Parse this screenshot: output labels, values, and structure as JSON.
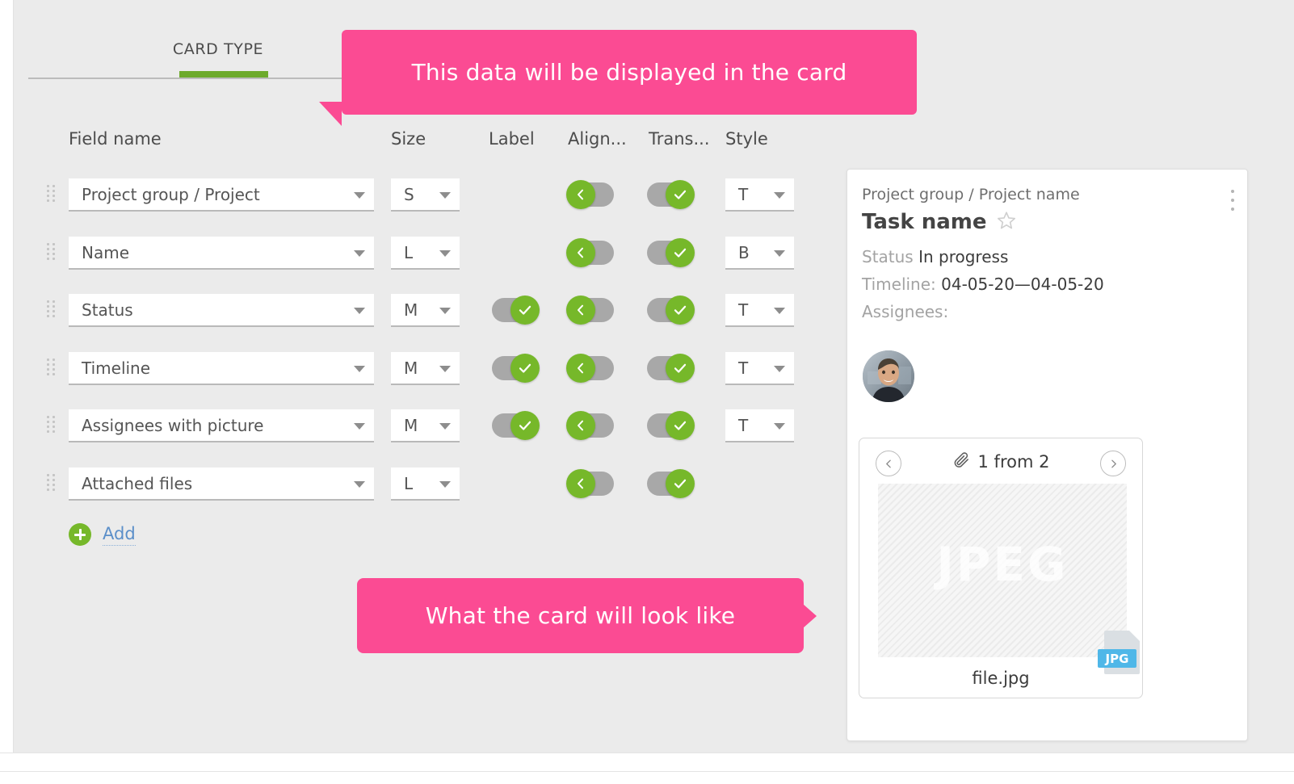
{
  "tabs": {
    "active_label": "CARD TYPE",
    "accent_color": "#6daa2c"
  },
  "columns": {
    "field_name": "Field name",
    "size": "Size",
    "label": "Label",
    "align": "Align...",
    "trans": "Trans...",
    "style": "Style"
  },
  "rows": [
    {
      "field": "Project group / Project",
      "size": "S",
      "label_toggle": null,
      "align_toggle": "off",
      "trans_toggle": "on",
      "style": "T"
    },
    {
      "field": "Name",
      "size": "L",
      "label_toggle": null,
      "align_toggle": "off",
      "trans_toggle": "on",
      "style": "B"
    },
    {
      "field": "Status",
      "size": "M",
      "label_toggle": "on",
      "align_toggle": "off",
      "trans_toggle": "on",
      "style": "T"
    },
    {
      "field": "Timeline",
      "size": "M",
      "label_toggle": "on",
      "align_toggle": "off",
      "trans_toggle": "on",
      "style": "T"
    },
    {
      "field": "Assignees with picture",
      "size": "M",
      "label_toggle": "on",
      "align_toggle": "off",
      "trans_toggle": "on",
      "style": "T"
    },
    {
      "field": "Attached files",
      "size": "L",
      "label_toggle": null,
      "align_toggle": "off",
      "trans_toggle": "on",
      "style": null
    }
  ],
  "add_button": {
    "label": "Add",
    "icon": "plus-circle-icon"
  },
  "callouts": {
    "top": "This data will be displayed in the card",
    "bottom": "What the card will look like",
    "color": "#fb4b93"
  },
  "preview": {
    "project": "Project group / Project name",
    "title": "Task name",
    "star_icon": "star-outline-icon",
    "menu_icon": "kebab-menu-icon",
    "status_label": "Status",
    "status_value": "In progress",
    "timeline_label": "Timeline:",
    "timeline_value": "04-05-20—04-05-20",
    "assignees_label": "Assignees:",
    "avatar_name": "assignee-avatar",
    "attachment": {
      "clip_icon": "paperclip-icon",
      "count": "1 from 2",
      "prev_icon": "chevron-left-circle-icon",
      "next_icon": "chevron-right-circle-icon",
      "placeholder_text": "JPEG",
      "badge_ext": "JPG",
      "badge_color": "#4fb7e8",
      "file_name": "file.jpg"
    }
  }
}
